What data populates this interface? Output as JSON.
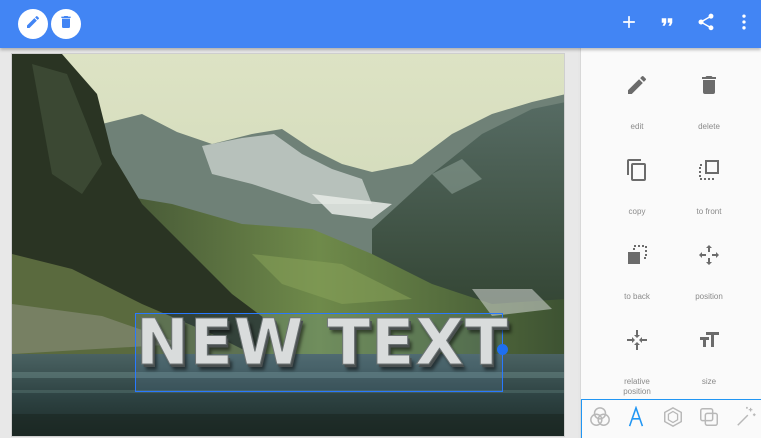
{
  "toolbar": {
    "edit_button_icon": "pencil-icon",
    "delete_button_icon": "trash-icon",
    "actions": [
      "add-icon",
      "quote-icon",
      "share-icon",
      "more-vert-icon"
    ],
    "color": "#4285f4"
  },
  "canvas": {
    "text_layer": "NEW TEXT",
    "selection_color": "#2979ff"
  },
  "side_panel": {
    "tools": [
      {
        "label": "edit",
        "icon": "pencil-icon"
      },
      {
        "label": "delete",
        "icon": "trash-icon"
      },
      {
        "label": "copy",
        "icon": "copy-icon"
      },
      {
        "label": "to front",
        "icon": "bring-to-front-icon"
      },
      {
        "label": "to back",
        "icon": "send-to-back-icon"
      },
      {
        "label": "position",
        "icon": "move-arrows-icon"
      },
      {
        "label": "relative\nposition",
        "icon": "relative-position-icon"
      },
      {
        "label": "size",
        "icon": "text-size-icon"
      }
    ],
    "tabs": [
      {
        "icon": "color-circles-icon",
        "active": false
      },
      {
        "icon": "font-A-icon",
        "active": true
      },
      {
        "icon": "hexagon-icon",
        "active": false
      },
      {
        "icon": "shadow-squares-icon",
        "active": false
      },
      {
        "icon": "magic-wand-icon",
        "active": false
      }
    ],
    "accent": "#2196f3"
  }
}
